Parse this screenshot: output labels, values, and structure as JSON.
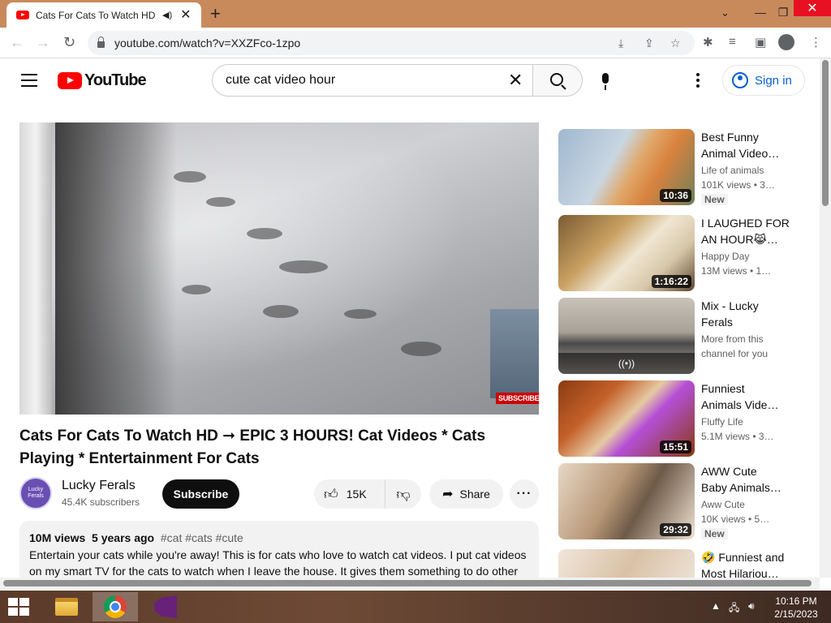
{
  "browser": {
    "tab_title": "Cats For Cats To Watch HD ➞ EPIC 3 HOURS! Cat Videos * Cats Playing * Entertainment For Cats",
    "tab_title_visible": "Cats For Cats To Watch HD –",
    "url": "youtube.com/watch?v=XXZFco-1zpo"
  },
  "youtube": {
    "logo_text": "YouTube",
    "search_value": "cute cat video hour",
    "search_placeholder": "Search",
    "signin_label": "Sign in"
  },
  "video": {
    "watermark": "SUBSCRIBE",
    "title": "Cats For Cats To Watch HD ➞ EPIC 3 HOURS! Cat Videos * Cats Playing * Entertainment For Cats",
    "channel": "Lucky Ferals",
    "channel_avatar_text": "Lucky Ferals",
    "subscribers": "45.4K subscribers",
    "subscribe_label": "Subscribe",
    "likes": "15K",
    "share_label": "Share",
    "views": "10M views",
    "age": "5 years ago",
    "hashtags": "#cat #cats #cute",
    "description": "Entertain your cats while you're away! This is for cats who love to watch cat videos. I put cat videos on my smart TV for the cats to watch when I leave the house. It gives them something to do other"
  },
  "recommendations": [
    {
      "title1": "Best Funny",
      "title2": "Animal Video…",
      "channel": "Life of animals",
      "meta": "101K views  • 3…",
      "duration": "10:36",
      "badge": "New"
    },
    {
      "title1": "I LAUGHED FOR",
      "title2": "AN HOUR😹…",
      "channel": "Happy Day",
      "meta": "13M views  • 1…",
      "duration": "1:16:22",
      "badge": ""
    },
    {
      "title1": "Mix - Lucky",
      "title2": "Ferals",
      "channel": "More from this",
      "meta": "channel for you",
      "duration": "",
      "badge": "",
      "mix_icon": "((•))"
    },
    {
      "title1": "Funniest",
      "title2": "Animals Vide…",
      "channel": "Fluffy Life",
      "meta": "5.1M views  • 3…",
      "duration": "15:51",
      "badge": ""
    },
    {
      "title1": "AWW Cute",
      "title2": "Baby Animals…",
      "channel": "Aww Cute",
      "meta": "10K views  • 5…",
      "duration": "29:32",
      "badge": "New"
    },
    {
      "title1": "🤣 Funniest and",
      "title2": "Most Hilariou…",
      "channel": "",
      "meta": "",
      "duration": "",
      "badge": ""
    }
  ],
  "taskbar": {
    "time": "10:16 PM",
    "date": "2/15/2023"
  },
  "colors": {
    "yt_red": "#ff0000",
    "link_blue": "#065fd4",
    "titlebar": "#c98a5b"
  }
}
